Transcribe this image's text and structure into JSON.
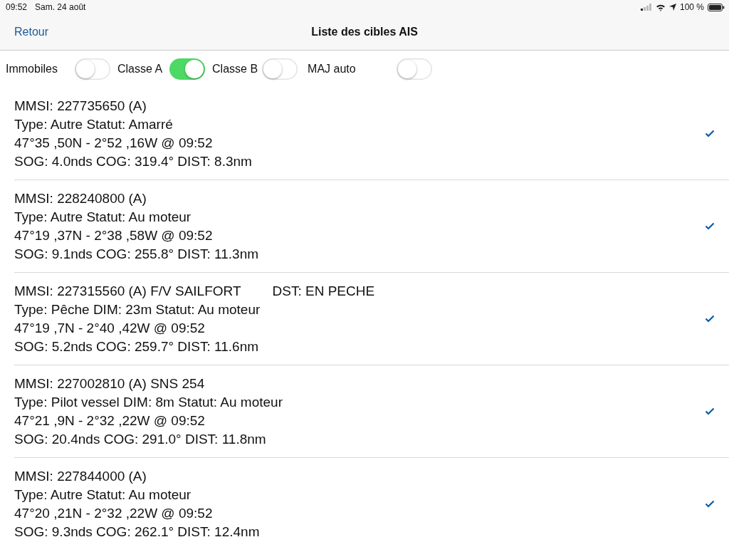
{
  "status_bar": {
    "time": "09:52",
    "date": "Sam. 24 août",
    "battery": "100 %"
  },
  "nav": {
    "back": "Retour",
    "title": "Liste des cibles AIS"
  },
  "filters": [
    {
      "label": "Immobiles",
      "on": false
    },
    {
      "label": "Classe A",
      "on": true
    },
    {
      "label": "Classe B",
      "on": false
    },
    {
      "label": "MAJ auto",
      "on": false
    }
  ],
  "targets": [
    {
      "lines": [
        "MMSI: 227735650 (A)",
        "Type: Autre Statut: Amarré",
        "47°35 ,50N - 2°52 ,16W @ 09:52",
        "SOG: 4.0nds COG: 319.4° DIST: 8.3nm"
      ],
      "checked": true
    },
    {
      "lines": [
        "MMSI: 228240800 (A)",
        "Type: Autre Statut: Au moteur",
        "47°19 ,37N - 2°38 ,58W @ 09:52",
        "SOG: 9.1nds COG: 255.8° DIST: 11.3nm"
      ],
      "checked": true
    },
    {
      "lines": [
        "MMSI: 227315560 (A) F/V SAILFORT",
        "Type: Pêche DIM: 23m Statut: Au moteur",
        "47°19 ,7N - 2°40 ,42W @ 09:52",
        "SOG: 5.2nds COG: 259.7° DIST: 11.6nm"
      ],
      "destination": "DST: EN PECHE",
      "checked": true
    },
    {
      "lines": [
        "MMSI: 227002810 (A) SNS 254",
        "Type: Pilot vessel DIM: 8m Statut: Au moteur",
        "47°21 ,9N - 2°32 ,22W @ 09:52",
        "SOG: 20.4nds COG: 291.0° DIST: 11.8nm"
      ],
      "checked": true
    },
    {
      "lines": [
        "MMSI: 227844000 (A)",
        "Type: Autre Statut: Au moteur",
        "47°20 ,21N - 2°32 ,22W @ 09:52",
        "SOG: 9.3nds COG: 262.1° DIST: 12.4nm"
      ],
      "checked": true
    }
  ]
}
